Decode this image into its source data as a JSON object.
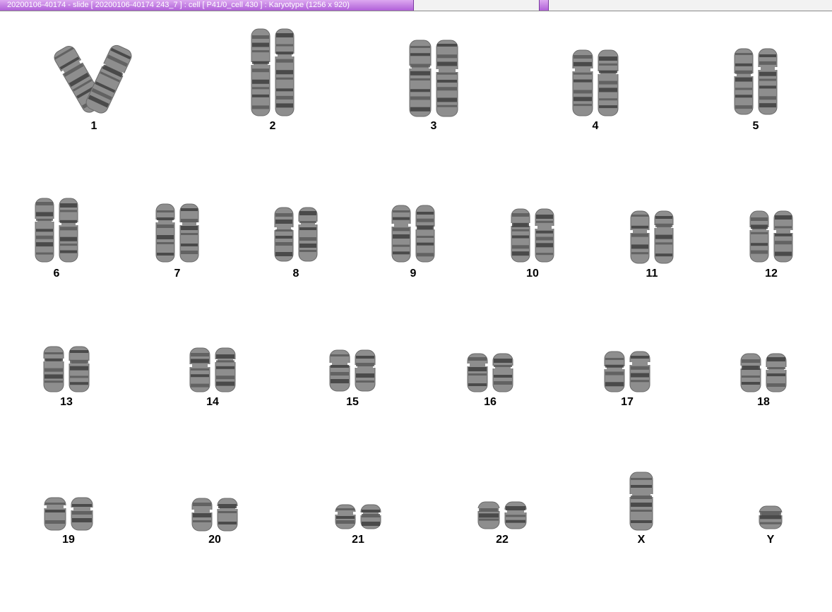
{
  "window": {
    "title": "20200106-40174 - slide [ 20200106-40174 243_7 ] : cell [ P41/0_cell 430 ] : Karyotype  (1256 x 920)"
  },
  "karyogram": {
    "chromosomes": [
      {
        "label": "1"
      },
      {
        "label": "2"
      },
      {
        "label": "3"
      },
      {
        "label": "4"
      },
      {
        "label": "5"
      },
      {
        "label": "6"
      },
      {
        "label": "7"
      },
      {
        "label": "8"
      },
      {
        "label": "9"
      },
      {
        "label": "10"
      },
      {
        "label": "11"
      },
      {
        "label": "12"
      },
      {
        "label": "13"
      },
      {
        "label": "14"
      },
      {
        "label": "15"
      },
      {
        "label": "16"
      },
      {
        "label": "17"
      },
      {
        "label": "18"
      },
      {
        "label": "19"
      },
      {
        "label": "20"
      },
      {
        "label": "21"
      },
      {
        "label": "22"
      },
      {
        "label": "X"
      },
      {
        "label": "Y"
      }
    ]
  }
}
